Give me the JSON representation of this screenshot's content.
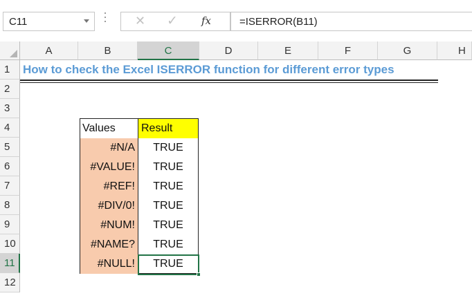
{
  "formula_bar": {
    "name_box": "C11",
    "fx_label": "fx",
    "formula": "=ISERROR(B11)"
  },
  "columns": [
    "A",
    "B",
    "C",
    "D",
    "E",
    "F",
    "G",
    "H"
  ],
  "rows": [
    "1",
    "2",
    "3",
    "4",
    "5",
    "6",
    "7",
    "8",
    "9",
    "10",
    "11",
    "12"
  ],
  "active_cell": {
    "column": "C",
    "row": "11"
  },
  "sheet": {
    "title": "How to check the Excel ISERROR function for different error types",
    "table": {
      "header_values": "Values",
      "header_result": "Result",
      "values": [
        "#N/A",
        "#VALUE!",
        "#REF!",
        "#DIV/0!",
        "#NUM!",
        "#NAME?",
        "#NULL!"
      ],
      "results": [
        "TRUE",
        "TRUE",
        "TRUE",
        "TRUE",
        "TRUE",
        "TRUE",
        "TRUE"
      ]
    }
  },
  "colors": {
    "title": "#5b9bd5",
    "values_fill": "#f8cbad",
    "result_header_fill": "#ffff00",
    "selection": "#217346"
  }
}
